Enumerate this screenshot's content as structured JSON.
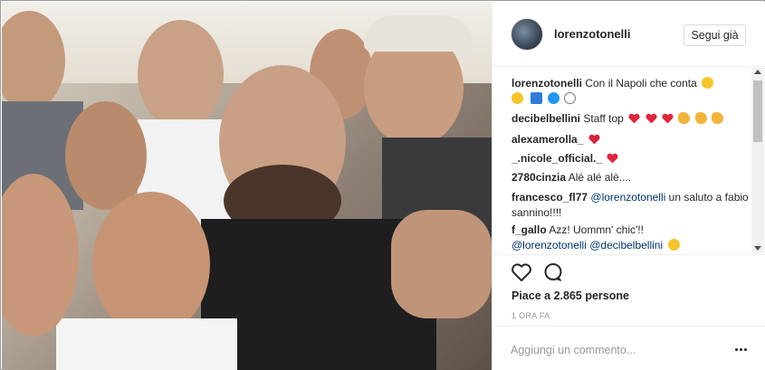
{
  "post": {
    "username": "lorenzotonelli",
    "follow_label": "Segui già"
  },
  "comments": [
    {
      "user": "lorenzotonelli",
      "text": "Con il Napoli che conta",
      "emojis": [
        "grinning-face-emoji",
        "grinning-face-emoji",
        "top-emoji",
        "blue-circle-emoji",
        "white-circle-emoji"
      ]
    },
    {
      "user": "decibelbellini",
      "text": "Staff top",
      "emojis": [
        "red-heart-emoji",
        "red-heart-emoji",
        "red-heart-emoji",
        "clapping-hands-emoji",
        "clapping-hands-emoji",
        "clapping-hands-emoji"
      ]
    },
    {
      "user": "alexamerolla_",
      "text": "",
      "emojis": [
        "heart-emoji"
      ]
    },
    {
      "user": "_.nicole_official._",
      "text": "",
      "emojis": [
        "red-heart-emoji"
      ]
    },
    {
      "user": "2780cinzia",
      "text": "Alé alé alè....",
      "emojis": []
    },
    {
      "user": "francesco_fl77",
      "mention": "@lorenzotonelli",
      "text": "un saluto a fabio sannino!!!!",
      "emojis": []
    },
    {
      "user": "f_gallo",
      "text": "Azz! Uommn' chic'!!",
      "mention1": "@lorenzotonelli",
      "mention2": "@decibelbellini",
      "emojis": [
        "laughing-face-emoji"
      ]
    }
  ],
  "likes_text": "Piace a 2.865 persone",
  "time_text": "1 ORA FA",
  "add_comment": {
    "placeholder": "Aggiungi un commento..."
  },
  "colors": {
    "link": "#003569",
    "heart": "#ed2939",
    "muted": "#999999"
  }
}
